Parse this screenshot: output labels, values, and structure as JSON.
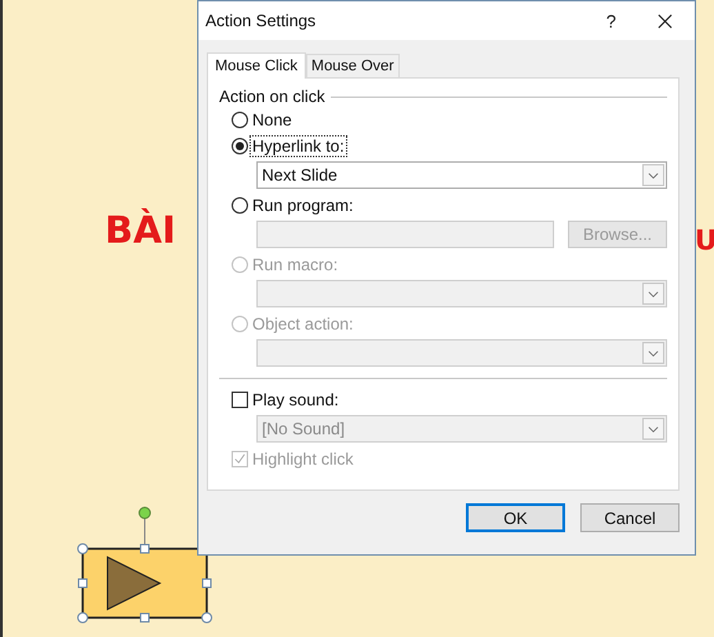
{
  "slide": {
    "title_parts": [
      "BÀI",
      "U"
    ],
    "action_button": {
      "selected": true
    }
  },
  "dialog": {
    "title": "Action Settings",
    "help": "?",
    "tabs": [
      {
        "label": "Mouse Click",
        "selected": true
      },
      {
        "label": "Mouse Over",
        "selected": false
      }
    ],
    "group_label": "Action on click",
    "options": [
      {
        "label": "None",
        "selected": false,
        "disabled": false
      },
      {
        "label": "Hyperlink to:",
        "selected": true,
        "disabled": false,
        "control": {
          "kind": "dropdown",
          "value": "Next Slide",
          "disabled": false
        }
      },
      {
        "label": "Run program:",
        "selected": false,
        "disabled": false,
        "control": {
          "kind": "textbox",
          "disabled": true,
          "button": "Browse..."
        }
      },
      {
        "label": "Run macro:",
        "selected": false,
        "disabled": true,
        "control": {
          "kind": "dropdown",
          "disabled": true
        }
      },
      {
        "label": "Object action:",
        "selected": false,
        "disabled": true,
        "control": {
          "kind": "dropdown",
          "disabled": true
        }
      }
    ],
    "play_sound": {
      "label": "Play sound:",
      "checked": false,
      "value": "[No Sound]",
      "disabled": true
    },
    "highlight_click": {
      "label": "Highlight click",
      "checked": true,
      "disabled": true
    },
    "buttons": [
      {
        "label": "OK",
        "default": true
      },
      {
        "label": "Cancel",
        "default": false
      }
    ]
  }
}
